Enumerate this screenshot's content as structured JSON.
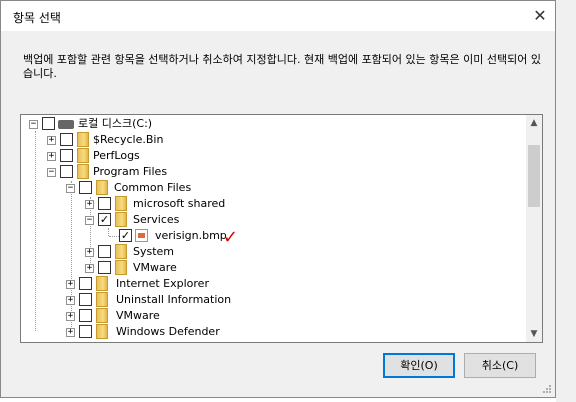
{
  "dialog": {
    "title": "항목 선택",
    "description": "백업에 포함할 관련 항목을 선택하거나 취소하여 지정합니다. 현재 백업에 포함되어 있는 항목은 이미 선택되어 있습니다.",
    "ok_label": "확인(O)",
    "cancel_label": "취소(C)"
  },
  "tree": {
    "root": "로컬 디스크(C:)",
    "items": [
      {
        "label": "$Recycle.Bin"
      },
      {
        "label": "PerfLogs"
      },
      {
        "label": "Program Files"
      },
      {
        "label": "Common Files"
      },
      {
        "label": "microsoft shared"
      },
      {
        "label": "Services"
      },
      {
        "label": "verisign.bmp"
      },
      {
        "label": "System"
      },
      {
        "label": "VMware"
      },
      {
        "label": "Internet Explorer"
      },
      {
        "label": "Uninstall Information"
      },
      {
        "label": "VMware"
      },
      {
        "label": "Windows Defender"
      }
    ]
  },
  "annotation": "✓"
}
